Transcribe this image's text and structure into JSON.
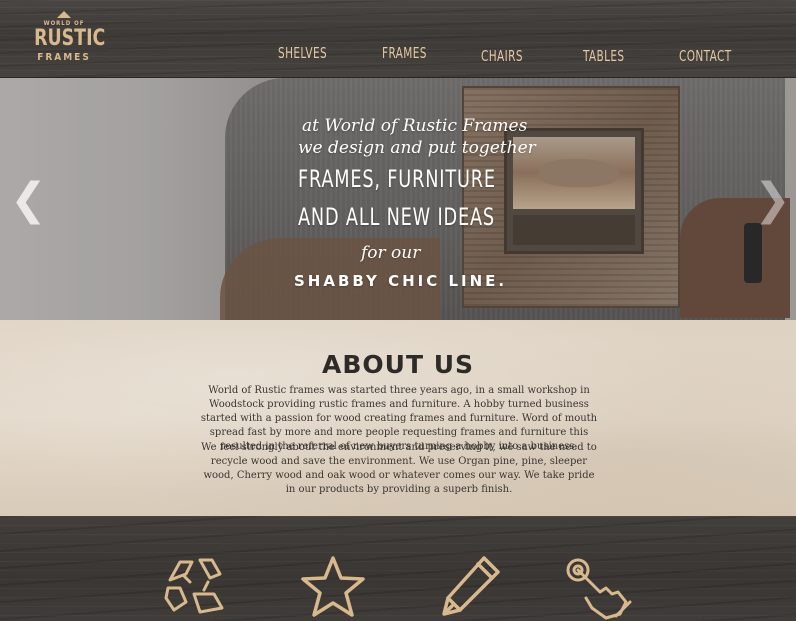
{
  "logo": {
    "top_line": "WORLD OF",
    "main": "RUSTIC",
    "sub": "FRAMES"
  },
  "nav": {
    "shelves": "SHELVES",
    "frames": "FRAMES",
    "chairs": "CHAIRS",
    "tables": "TABLES",
    "contact": "CONTACT"
  },
  "hero": {
    "line1": "at World of Rustic Frames",
    "line2": "we design and put together",
    "line3": "FRAMES, FURNITURE",
    "line4": "AND ALL NEW IDEAS",
    "line5": "for our",
    "line6": "SHABBY CHIC LINE.",
    "prev_arrow": "❮",
    "next_arrow": "❯"
  },
  "about": {
    "title": "ABOUT US",
    "paragraph1": "World of Rustic frames was started three years ago, in a small workshop in Woodstock providing rustic frames and furniture. A hobby turned business started with a passion for wood creating frames and furniture. Word of mouth spread fast by more and more people requesting frames and furniture this resulted in the referral of new buyers turning a hobby into a business.",
    "paragraph2": "We feel strongly about the environment and preserving it, we saw the need to recycle wood and save the environment. We use Organ pine, pine, sleeper wood, Cherry wood and oak wood or whatever comes our way. We take pride in our products by providing a superb finish."
  },
  "features": {
    "icons": [
      "recycle-icon",
      "star-icon",
      "pencil-icon",
      "touch-hand-icon"
    ]
  },
  "colors": {
    "accent": "#d8b98e",
    "nav_text": "#e4c9a0",
    "header_bg": "#3f3b38",
    "about_bg": "#e0d5c6",
    "title_text": "#2e2a28"
  }
}
